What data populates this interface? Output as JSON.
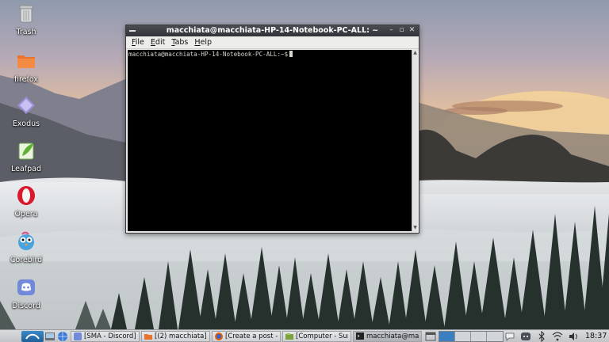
{
  "desktop": {
    "icons": [
      {
        "label": "Trash",
        "icon": "trash-icon"
      },
      {
        "label": "firefox",
        "icon": "folder-icon"
      },
      {
        "label": "Exodus",
        "icon": "exodus-icon"
      },
      {
        "label": "Leafpad",
        "icon": "leafpad-icon"
      },
      {
        "label": "Opera",
        "icon": "opera-icon"
      },
      {
        "label": "Corebird",
        "icon": "corebird-icon"
      },
      {
        "label": "Discord",
        "icon": "discord-icon"
      }
    ]
  },
  "terminal": {
    "title": "macchiata@macchiata-HP-14-Notebook-PC-ALL: ~",
    "menu": [
      {
        "label": "File",
        "mnemonic": "F"
      },
      {
        "label": "Edit",
        "mnemonic": "E"
      },
      {
        "label": "Tabs",
        "mnemonic": "T"
      },
      {
        "label": "Help",
        "mnemonic": "H"
      }
    ],
    "prompt": "macchiata@macchiata-HP-14-Notebook-PC-ALL:~$"
  },
  "taskbar": {
    "tasks": [
      {
        "label": "[SMA - Discord]",
        "icon": "discord-icon"
      },
      {
        "label": "[(2) macchiata]",
        "icon": "folder-icon"
      },
      {
        "label": "[Create a post — ...",
        "icon": "firefox-icon"
      },
      {
        "label": "[Computer - Sum...",
        "icon": "file-manager-icon"
      },
      {
        "label": "macchiata@mac...",
        "icon": "terminal-icon"
      }
    ],
    "clock": "18:37"
  },
  "colors": {
    "accent": "#3b7fc0",
    "titlebar": "#2f3236",
    "terminal_bg": "#000000",
    "terminal_fg": "#d3d7cf"
  }
}
